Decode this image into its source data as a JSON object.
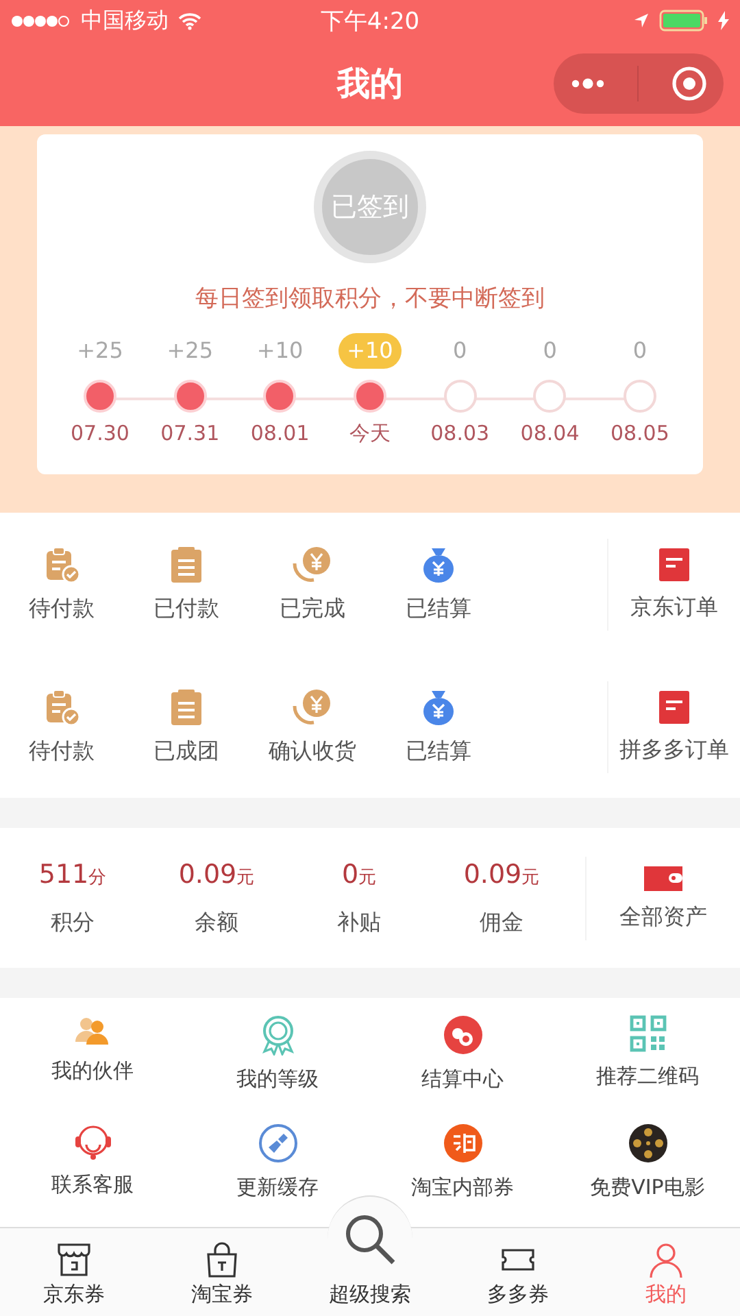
{
  "status_bar": {
    "carrier": "中国移动",
    "time": "下午4:20"
  },
  "nav": {
    "title": "我的"
  },
  "signin": {
    "button": "已签到",
    "hint": "每日签到领取积分，不要中断签到",
    "days": [
      {
        "points": "+25",
        "date": "07.30",
        "checked": true,
        "selected": false
      },
      {
        "points": "+25",
        "date": "07.31",
        "checked": true,
        "selected": false
      },
      {
        "points": "+10",
        "date": "08.01",
        "checked": true,
        "selected": false
      },
      {
        "points": "+10",
        "date": "今天",
        "checked": true,
        "selected": true
      },
      {
        "points": "0",
        "date": "08.03",
        "checked": false,
        "selected": false
      },
      {
        "points": "0",
        "date": "08.04",
        "checked": false,
        "selected": false
      },
      {
        "points": "0",
        "date": "08.05",
        "checked": false,
        "selected": false
      }
    ]
  },
  "order_rows": [
    {
      "items": [
        "待付款",
        "已付款",
        "已完成",
        "已结算"
      ],
      "link": "京东订单"
    },
    {
      "items": [
        "待付款",
        "已成团",
        "确认收货",
        "已结算"
      ],
      "link": "拼多多订单"
    }
  ],
  "stats": {
    "items": [
      {
        "value": "511",
        "unit": "分",
        "label": "积分"
      },
      {
        "value": "0.09",
        "unit": "元",
        "label": "余额"
      },
      {
        "value": "0",
        "unit": "元",
        "label": "补贴"
      },
      {
        "value": "0.09",
        "unit": "元",
        "label": "佣金"
      }
    ],
    "link": "全部资产"
  },
  "services": [
    "我的伙伴",
    "我的等级",
    "结算中心",
    "推荐二维码",
    "联系客服",
    "更新缓存",
    "淘宝内部券",
    "免费VIP电影"
  ],
  "tab_bar": [
    {
      "label": "京东券",
      "selected": false
    },
    {
      "label": "淘宝券",
      "selected": false
    },
    {
      "label": "超级搜索",
      "selected": false
    },
    {
      "label": "多多券",
      "selected": false
    },
    {
      "label": "我的",
      "selected": true
    }
  ]
}
